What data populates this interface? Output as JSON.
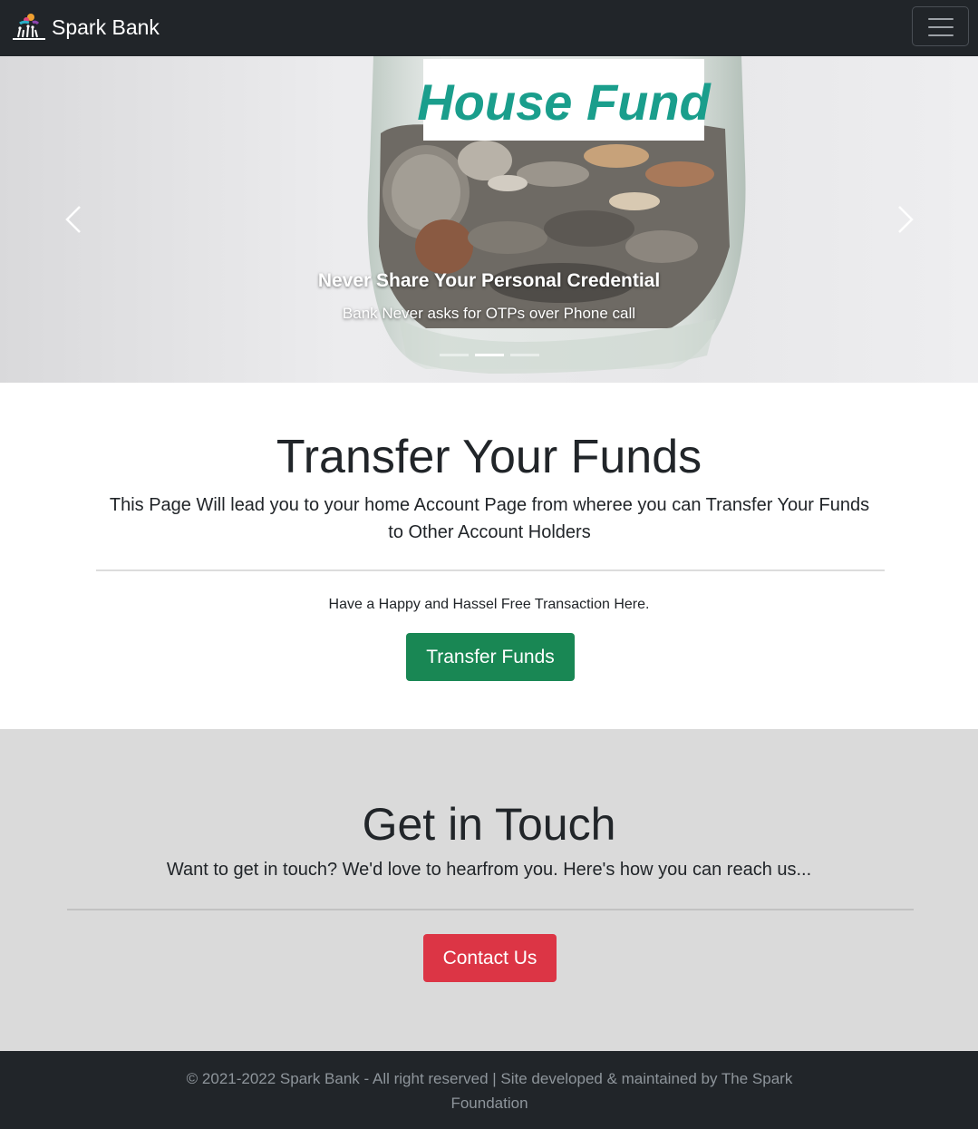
{
  "navbar": {
    "brand_name": "Spark Bank",
    "logo_icon": "spark-bank-logo",
    "menu_icon": "hamburger-menu-icon"
  },
  "carousel": {
    "jar_label": "House Fund",
    "caption_title": "Never Share Your Personal Credential",
    "caption_subtitle": "Bank Never asks for OTPs over Phone call",
    "prev_icon": "chevron-left-icon",
    "next_icon": "chevron-right-icon",
    "slide_count": 3,
    "active_slide": 2
  },
  "transfer": {
    "title": "Transfer Your Funds",
    "lead": "This Page Will lead you to your home Account Page from wheree you can Transfer Your Funds to Other Account Holders",
    "note": "Have a Happy and Hassel Free Transaction Here.",
    "button_label": "Transfer Funds"
  },
  "contact": {
    "title": "Get in Touch",
    "lead": "Want to get in touch? We'd love to hearfrom you. Here's how you can reach us...",
    "button_label": "Contact Us"
  },
  "footer": {
    "text": "© 2021-2022 Spark Bank - All right reserved | Site developed & maintained by The Spark Foundation"
  },
  "colors": {
    "navbar": "#212529",
    "success": "#198754",
    "danger": "#dc3545",
    "contact_bg": "#dadada",
    "footer_text": "#8e959b",
    "jar_label_text": "#1a9e8c"
  }
}
